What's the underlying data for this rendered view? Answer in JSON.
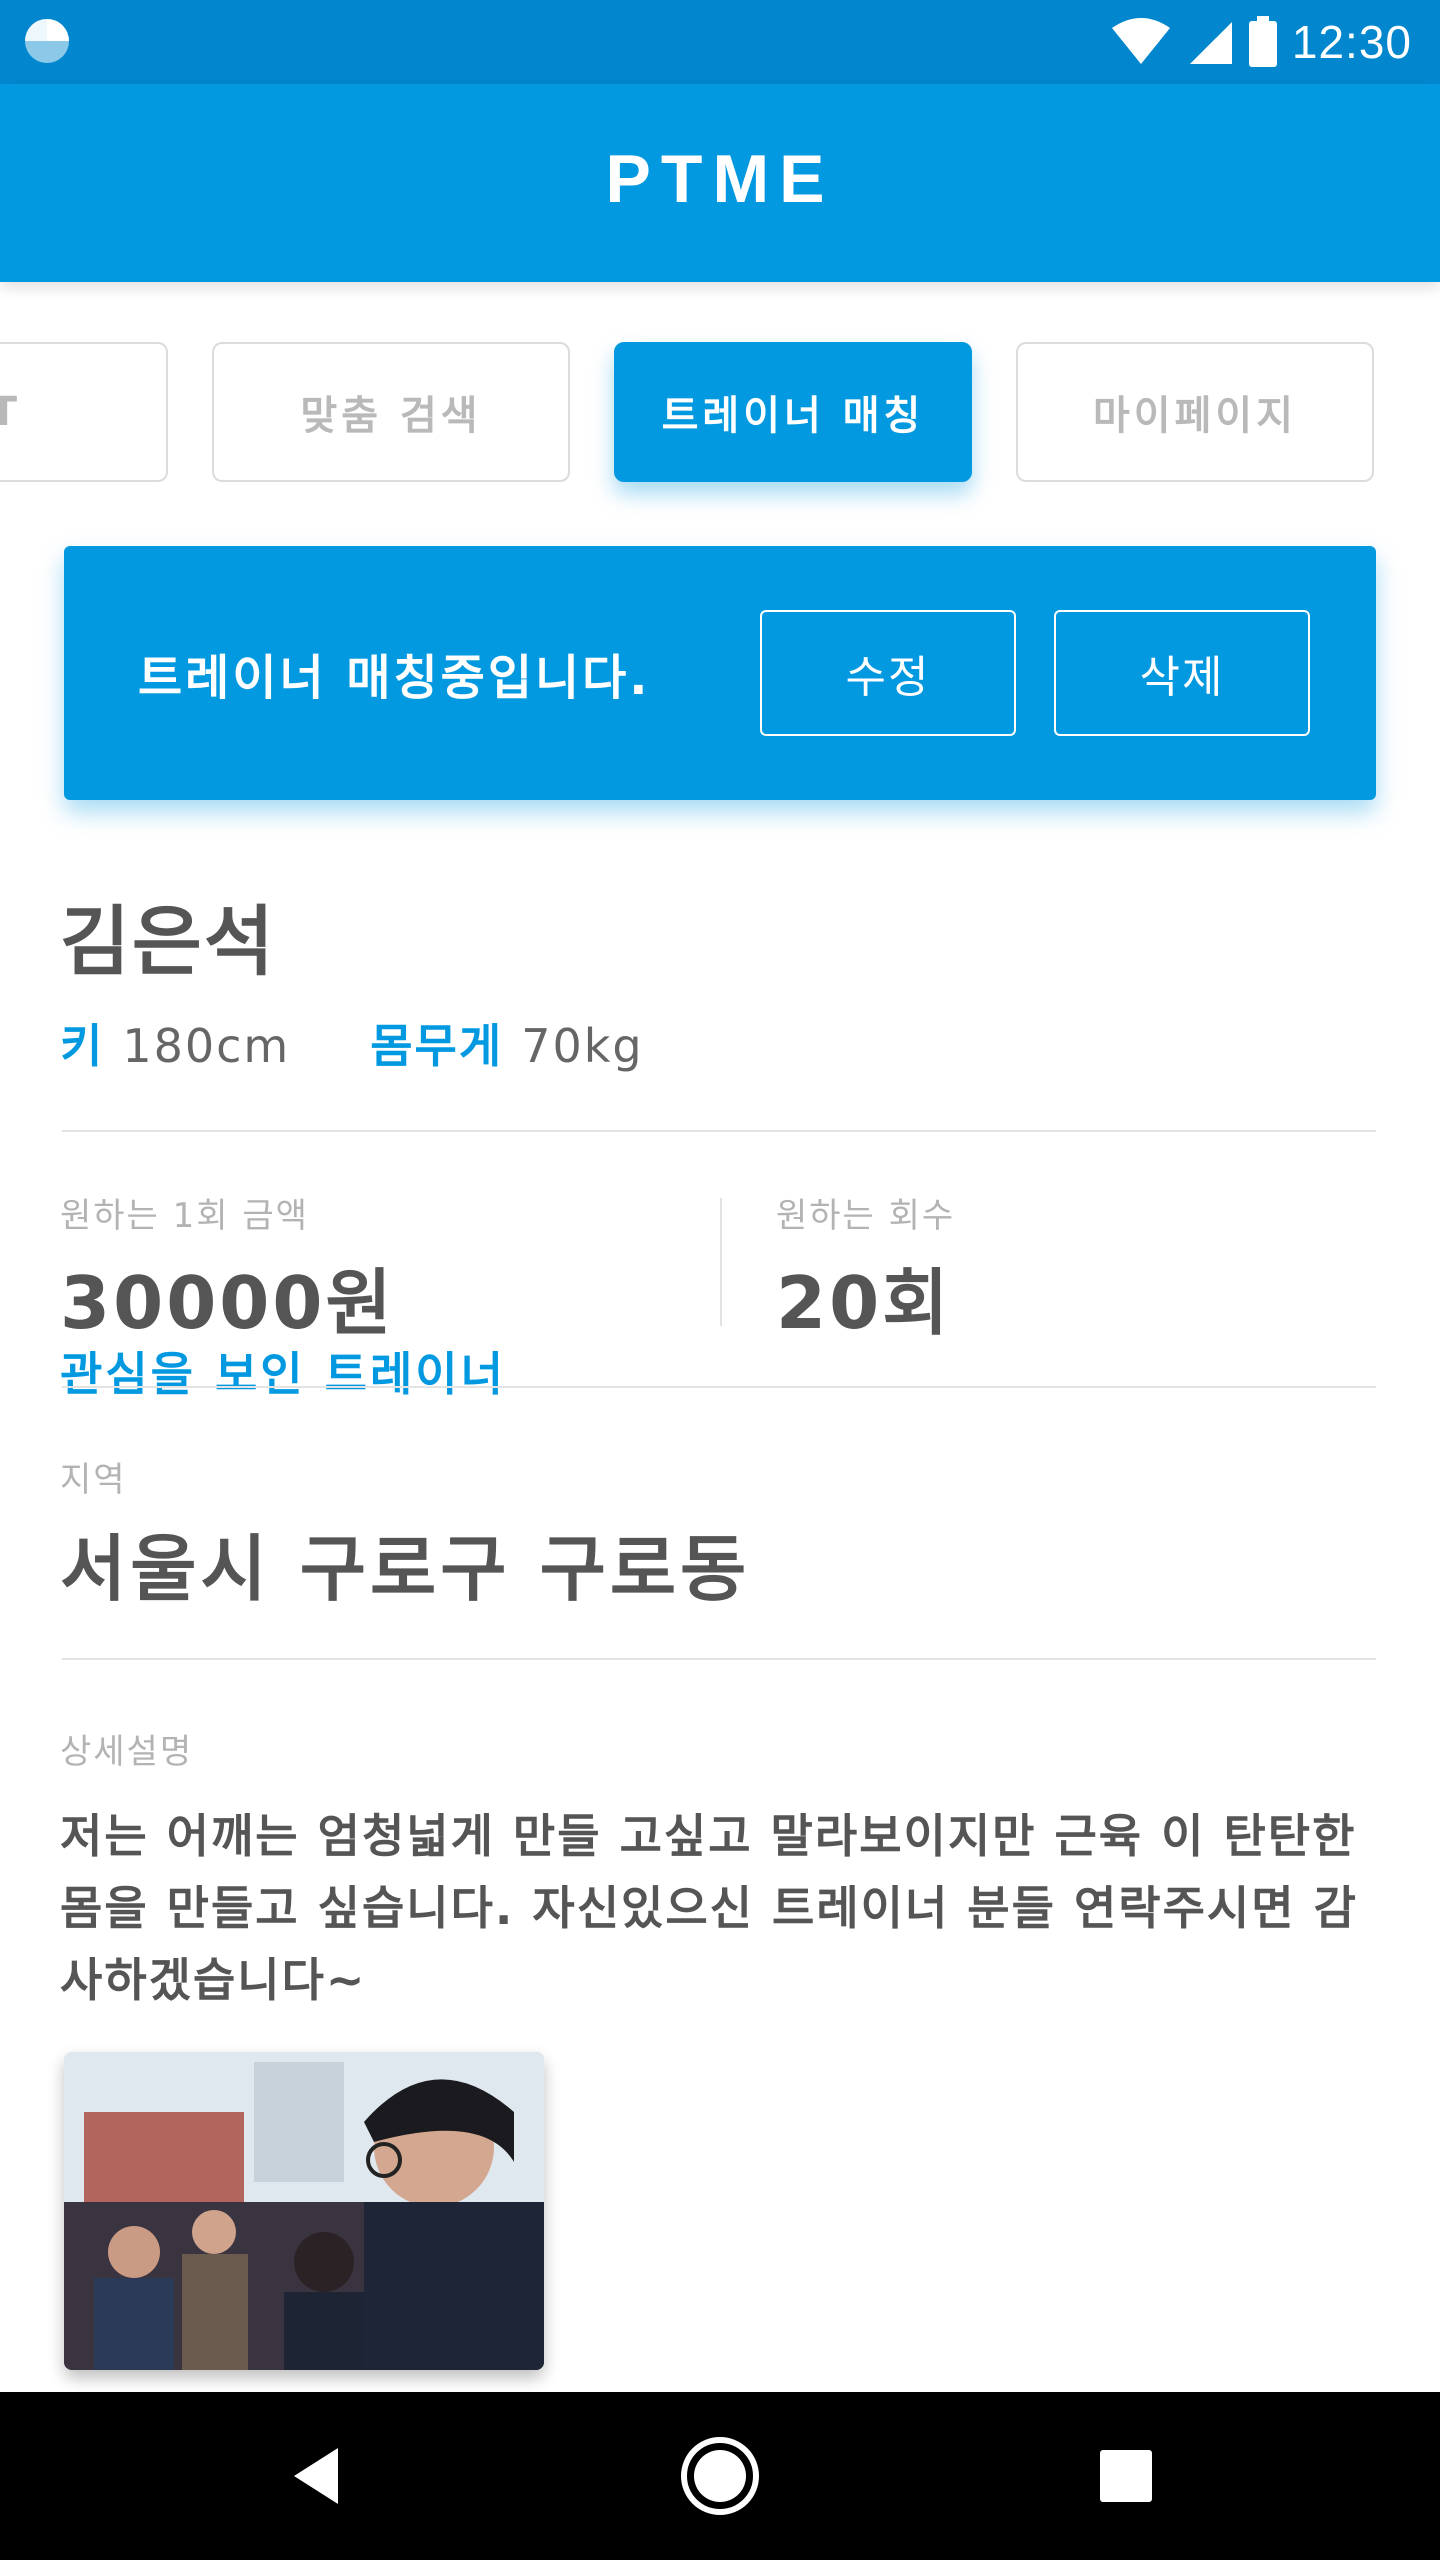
{
  "status_bar": {
    "time": "12:30",
    "icons": [
      "app-notification-icon",
      "wifi-icon",
      "cell-signal-icon",
      "battery-icon"
    ]
  },
  "app_bar": {
    "title": "PTME"
  },
  "tabs": [
    {
      "label": "ST",
      "active": false
    },
    {
      "label": "맞춤 검색",
      "active": false
    },
    {
      "label": "트레이너 매칭",
      "active": true
    },
    {
      "label": "마이페이지",
      "active": false
    }
  ],
  "banner": {
    "text": "트레이너 매칭중입니다.",
    "edit_label": "수정",
    "delete_label": "삭제"
  },
  "profile": {
    "name": "김은석",
    "height_label": "키",
    "height_value": "180cm",
    "weight_label": "몸무게",
    "weight_value": "70kg"
  },
  "pricing": {
    "price_label": "원하는 1회 금액",
    "price_value": "30000원",
    "count_label": "원하는 회수",
    "count_value": "20회",
    "interested_link": "관심을 보인 트레이너"
  },
  "region": {
    "label": "지역",
    "value": "서울시 구로구 구로동"
  },
  "description": {
    "label": "상세설명",
    "text": "저는 어깨는 엄청넓게 만들 고싶고 말라보이지만 근육 이 탄탄한 몸을 만들고 싶습니다. 자신있으신 트레이너 분들 연락주시면 감사하겠습니다~"
  },
  "nav": {
    "icons": [
      "back-icon",
      "home-icon",
      "recents-icon"
    ]
  },
  "colors": {
    "primary": "#0399e0",
    "status_bar": "#0287cf",
    "text_dark": "#555555",
    "text_muted": "#b3b3b3"
  }
}
